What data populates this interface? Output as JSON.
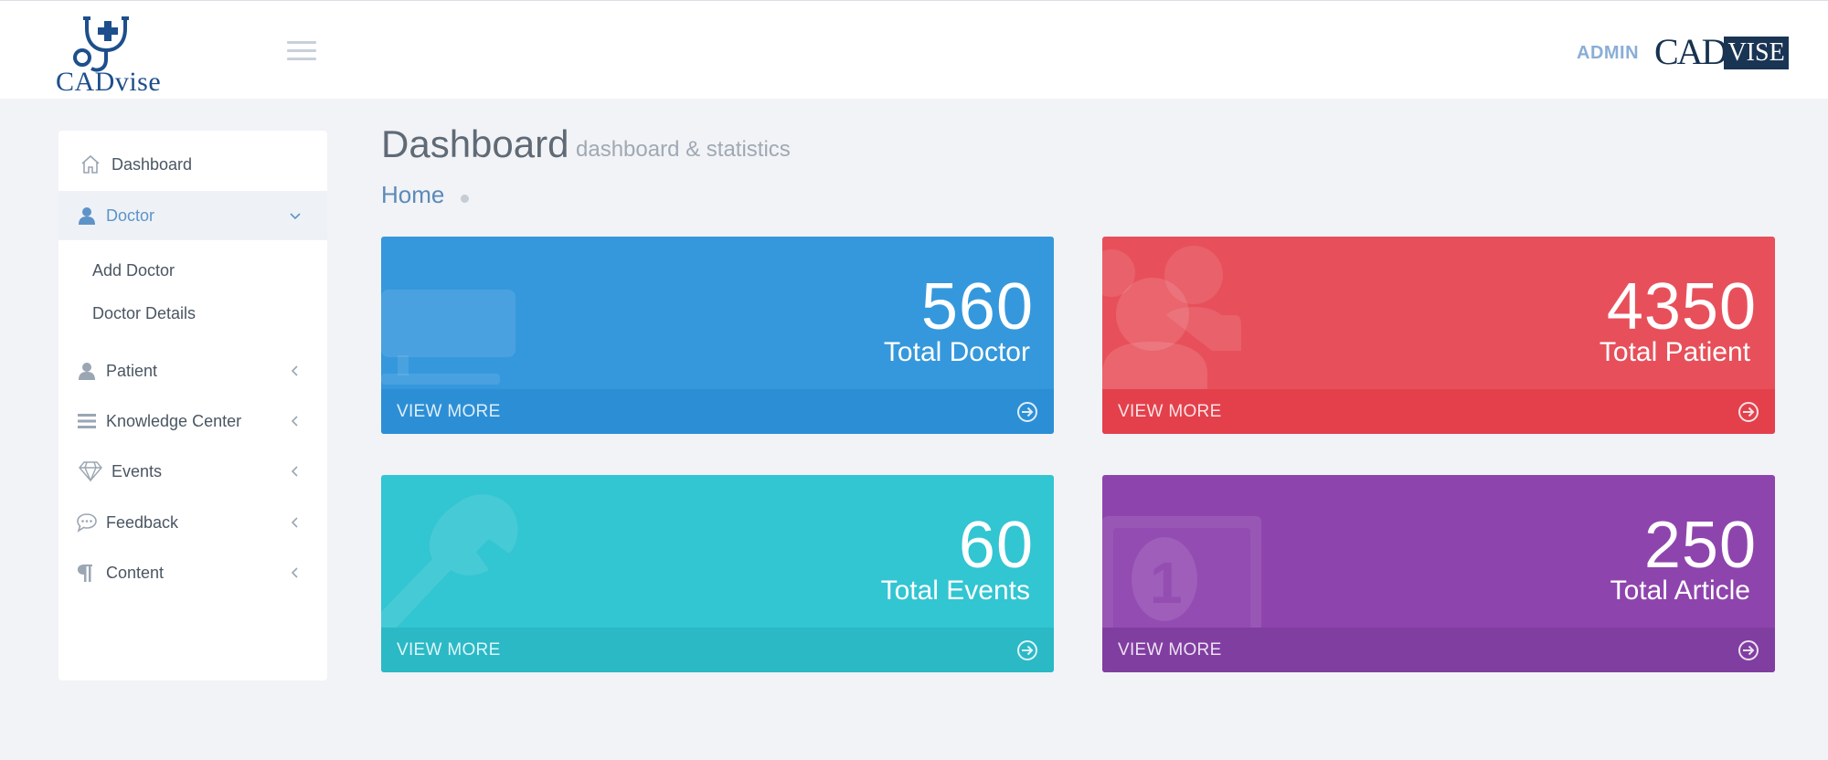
{
  "brand": {
    "logo_text": "CADvise",
    "right_logo_a": "CAD",
    "right_logo_b": "VISE",
    "accent": "#1d4f8c"
  },
  "header": {
    "user_label": "ADMIN"
  },
  "sidebar": {
    "items": [
      {
        "label": "Dashboard",
        "icon": "home-icon"
      },
      {
        "label": "Doctor",
        "icon": "user-icon",
        "expanded": true
      },
      {
        "label": "Patient",
        "icon": "user-icon"
      },
      {
        "label": "Knowledge Center",
        "icon": "list-icon"
      },
      {
        "label": "Events",
        "icon": "diamond-icon"
      },
      {
        "label": "Feedback",
        "icon": "comment-icon"
      },
      {
        "label": "Content",
        "icon": "paragraph-icon"
      }
    ],
    "doctor_submenu": [
      "Add Doctor",
      "Doctor Details"
    ]
  },
  "main": {
    "title": "Dashboard",
    "subtitle": "dashboard & statistics",
    "breadcrumb": "Home",
    "cards": [
      {
        "number": "560",
        "label": "Total Doctor",
        "footer": "VIEW MORE",
        "color": "#3598dc",
        "footer_color": "#2c8fd6",
        "icon": "desktop-icon"
      },
      {
        "number": "4350",
        "label": "Total Patient",
        "footer": "VIEW MORE",
        "color": "#e7505a",
        "footer_color": "#e3404c",
        "icon": "users-icon"
      },
      {
        "number": "60",
        "label": "Total Events",
        "footer": "VIEW MORE",
        "color": "#32c5d2",
        "footer_color": "#2bb9c6",
        "icon": "wrench-icon"
      },
      {
        "number": "250",
        "label": "Total Article",
        "footer": "VIEW MORE",
        "color": "#8e44ad",
        "footer_color": "#813ea1",
        "icon": "money-icon"
      }
    ]
  }
}
